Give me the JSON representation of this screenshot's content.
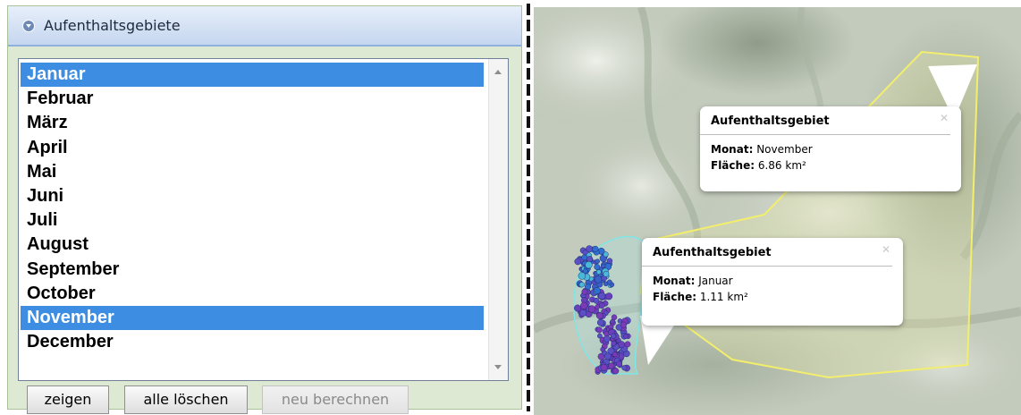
{
  "panel": {
    "title": "Aufenthaltsgebiete",
    "months": [
      "Januar",
      "Februar",
      "März",
      "April",
      "Mai",
      "Juni",
      "Juli",
      "August",
      "September",
      "October",
      "November",
      "December"
    ],
    "selected": [
      0,
      10
    ],
    "buttons": {
      "show": "zeigen",
      "clear_all": "alle löschen",
      "recalculate": "neu berechnen"
    }
  },
  "map": {
    "popups": [
      {
        "id": "nov",
        "title": "Aufenthaltsgebiet",
        "month_label": "Monat:",
        "month_value": "November",
        "area_label": "Fläche:",
        "area_value": "6.86 km²"
      },
      {
        "id": "jan",
        "title": "Aufenthaltsgebiet",
        "month_label": "Monat:",
        "month_value": "Januar",
        "area_label": "Fläche:",
        "area_value": "1.11 km²"
      }
    ]
  },
  "icons": {
    "collapse": "chevron-circle-icon",
    "popup_close": "close-icon"
  },
  "colors": {
    "selection": "#3d8ee3",
    "header_gradient_bottom": "#c5d6ef",
    "panel_background": "#dde9d3",
    "november_polygon": "#f3ee6c",
    "january_polygon": "#7fe6e8"
  }
}
